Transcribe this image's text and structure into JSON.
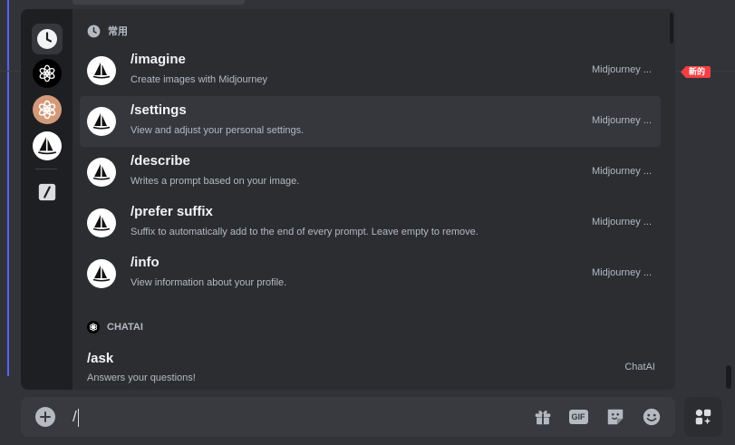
{
  "new_badge": "新的",
  "rail": {
    "items": [
      {
        "icon": "clock-icon"
      },
      {
        "icon": "chatgpt-logo-icon"
      },
      {
        "icon": "claude-logo-icon"
      },
      {
        "icon": "midjourney-logo-icon"
      },
      {
        "icon": "slash-command-icon"
      }
    ]
  },
  "sections": {
    "frequent": {
      "title": "常用"
    },
    "chatai": {
      "title": "CHATAI"
    }
  },
  "commands": [
    {
      "name": "/imagine",
      "desc": "Create images with Midjourney",
      "source": "Midjourney ..."
    },
    {
      "name": "/settings",
      "desc": "View and adjust your personal settings.",
      "source": "Midjourney ..."
    },
    {
      "name": "/describe",
      "desc": "Writes a prompt based on your image.",
      "source": "Midjourney ..."
    },
    {
      "name": "/prefer suffix",
      "desc": "Suffix to automatically add to the end of every prompt. Leave empty to remove.",
      "source": "Midjourney ..."
    },
    {
      "name": "/info",
      "desc": "View information about your profile.",
      "source": "Midjourney ..."
    }
  ],
  "chatai_commands": [
    {
      "name": "/ask",
      "desc": "Answers your questions!",
      "source": "ChatAI"
    }
  ],
  "composer": {
    "value": "/",
    "gif_label": "GIF"
  }
}
